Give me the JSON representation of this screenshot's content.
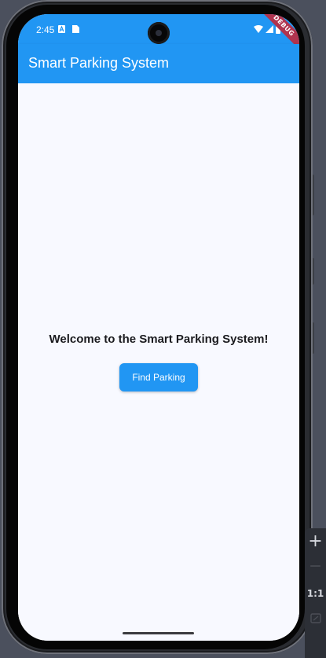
{
  "status_bar": {
    "time": "2:45",
    "debug_label": "DEBUG"
  },
  "app_bar": {
    "title": "Smart Parking System"
  },
  "main": {
    "welcome_text": "Welcome to the Smart Parking System!",
    "find_parking_label": "Find Parking"
  },
  "emulator_toolbar": {
    "zoom_in": "+",
    "zoom_out": "—",
    "ratio_label": "1:1"
  },
  "colors": {
    "primary": "#2196f3",
    "background": "#f8f9ff",
    "debug_banner": "#b0344f"
  },
  "icons": [
    "notification-a-icon",
    "sim-card-icon",
    "wifi-icon",
    "signal-icon",
    "battery-icon",
    "fit-screen-icon"
  ]
}
